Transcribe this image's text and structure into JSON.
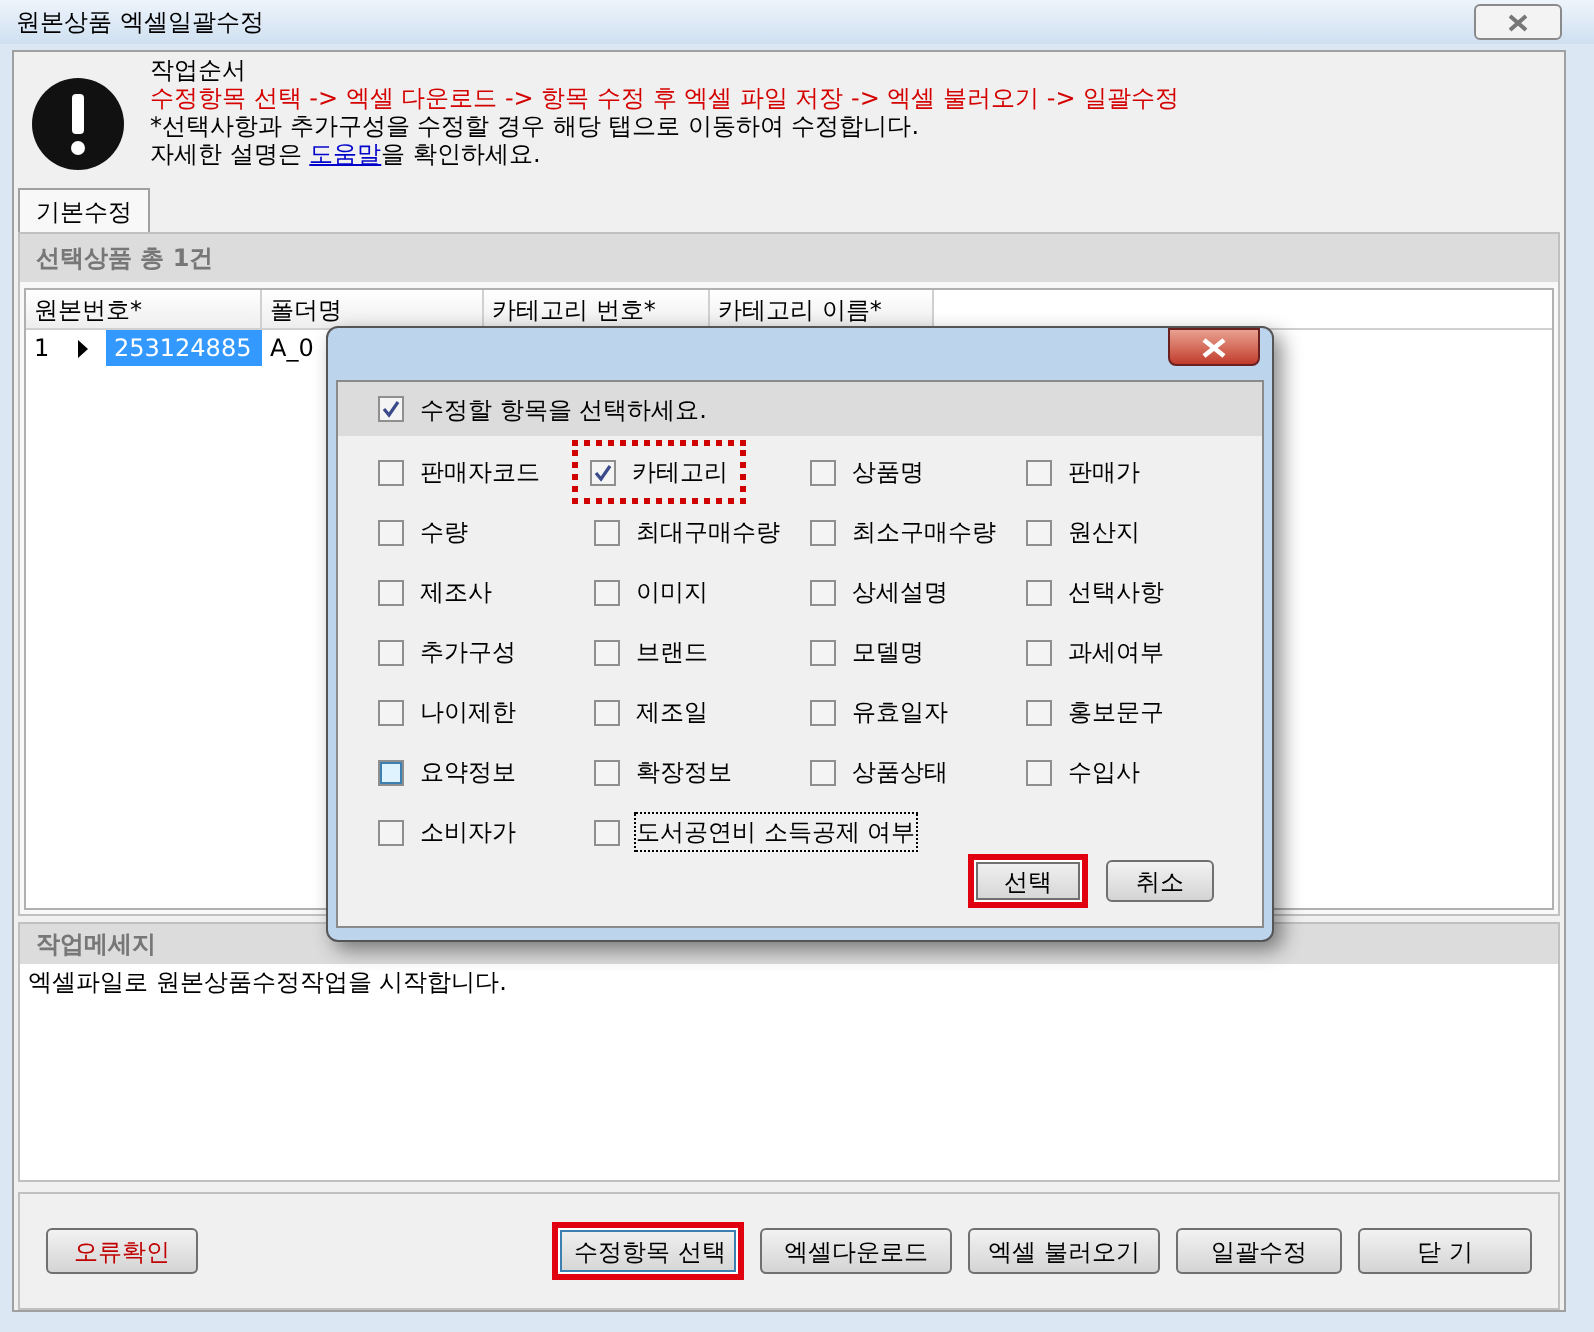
{
  "window": {
    "title": "원본상품 엑셀일괄수정"
  },
  "info": {
    "heading": "작업순서",
    "steps": "수정항목 선택 -> 엑셀 다운로드 -> 항목 수정 후 엑셀 파일 저장 -> 엑셀 불러오기 -> 일괄수정",
    "note": "*선택사항과 추가구성을 수정할 경우 해당 탭으로 이동하여 수정합니다.",
    "help_before": "자세한 설명은 ",
    "help_link": "도움말",
    "help_after": "을 확인하세요."
  },
  "tabs": [
    {
      "label": "기본수정",
      "selected": true
    }
  ],
  "selection": {
    "title": "선택상품 총 1건"
  },
  "table": {
    "columns": [
      "원본번호*",
      "폴더명",
      "카테고리 번호*",
      "카테고리 이름*"
    ],
    "rows": [
      {
        "index": "1",
        "current": true,
        "cells": [
          "253124885",
          "A_0"
        ],
        "selected": true
      }
    ]
  },
  "messages": {
    "title": "작업메세지",
    "text": "엑셀파일로 원본상품수정작업을 시작합니다."
  },
  "buttons": [
    {
      "label": "오류확인",
      "kind": "error",
      "highlighted": false
    },
    {
      "label": "수정항목 선택",
      "kind": "normal",
      "highlighted": true
    },
    {
      "label": "엑셀다운로드",
      "kind": "normal",
      "highlighted": false
    },
    {
      "label": "엑셀 불러오기",
      "kind": "normal",
      "highlighted": false
    },
    {
      "label": "일괄수정",
      "kind": "normal",
      "highlighted": false
    },
    {
      "label": "닫 기",
      "kind": "normal",
      "highlighted": false
    }
  ],
  "dialog": {
    "header": {
      "label": "수정할 항목을 선택하세요.",
      "checked": true
    },
    "items": [
      {
        "label": "판매자코드",
        "checked": false,
        "highlighted": false,
        "focused": false,
        "hot": false
      },
      {
        "label": "카테고리",
        "checked": true,
        "highlighted": true,
        "focused": false,
        "hot": false
      },
      {
        "label": "상품명",
        "checked": false,
        "highlighted": false,
        "focused": false,
        "hot": false
      },
      {
        "label": "판매가",
        "checked": false,
        "highlighted": false,
        "focused": false,
        "hot": false
      },
      {
        "label": "수량",
        "checked": false,
        "highlighted": false,
        "focused": false,
        "hot": false
      },
      {
        "label": "최대구매수량",
        "checked": false,
        "highlighted": false,
        "focused": false,
        "hot": false
      },
      {
        "label": "최소구매수량",
        "checked": false,
        "highlighted": false,
        "focused": false,
        "hot": false
      },
      {
        "label": "원산지",
        "checked": false,
        "highlighted": false,
        "focused": false,
        "hot": false
      },
      {
        "label": "제조사",
        "checked": false,
        "highlighted": false,
        "focused": false,
        "hot": false
      },
      {
        "label": "이미지",
        "checked": false,
        "highlighted": false,
        "focused": false,
        "hot": false
      },
      {
        "label": "상세설명",
        "checked": false,
        "highlighted": false,
        "focused": false,
        "hot": false
      },
      {
        "label": "선택사항",
        "checked": false,
        "highlighted": false,
        "focused": false,
        "hot": false
      },
      {
        "label": "추가구성",
        "checked": false,
        "highlighted": false,
        "focused": false,
        "hot": false
      },
      {
        "label": "브랜드",
        "checked": false,
        "highlighted": false,
        "focused": false,
        "hot": false
      },
      {
        "label": "모델명",
        "checked": false,
        "highlighted": false,
        "focused": false,
        "hot": false
      },
      {
        "label": "과세여부",
        "checked": false,
        "highlighted": false,
        "focused": false,
        "hot": false
      },
      {
        "label": "나이제한",
        "checked": false,
        "highlighted": false,
        "focused": false,
        "hot": false
      },
      {
        "label": "제조일",
        "checked": false,
        "highlighted": false,
        "focused": false,
        "hot": false
      },
      {
        "label": "유효일자",
        "checked": false,
        "highlighted": false,
        "focused": false,
        "hot": false
      },
      {
        "label": "홍보문구",
        "checked": false,
        "highlighted": false,
        "focused": false,
        "hot": false
      },
      {
        "label": "요약정보",
        "checked": false,
        "highlighted": false,
        "focused": false,
        "hot": true
      },
      {
        "label": "확장정보",
        "checked": false,
        "highlighted": false,
        "focused": false,
        "hot": false
      },
      {
        "label": "상품상태",
        "checked": false,
        "highlighted": false,
        "focused": false,
        "hot": false
      },
      {
        "label": "수입사",
        "checked": false,
        "highlighted": false,
        "focused": false,
        "hot": false
      },
      {
        "label": "소비자가",
        "checked": false,
        "highlighted": false,
        "focused": false,
        "hot": false
      },
      {
        "label": "도서공연비 소득공제 여부",
        "checked": false,
        "highlighted": false,
        "focused": true,
        "hot": false
      }
    ],
    "buttons": [
      {
        "label": "선택",
        "highlighted": true
      },
      {
        "label": "취소",
        "highlighted": false
      }
    ]
  }
}
